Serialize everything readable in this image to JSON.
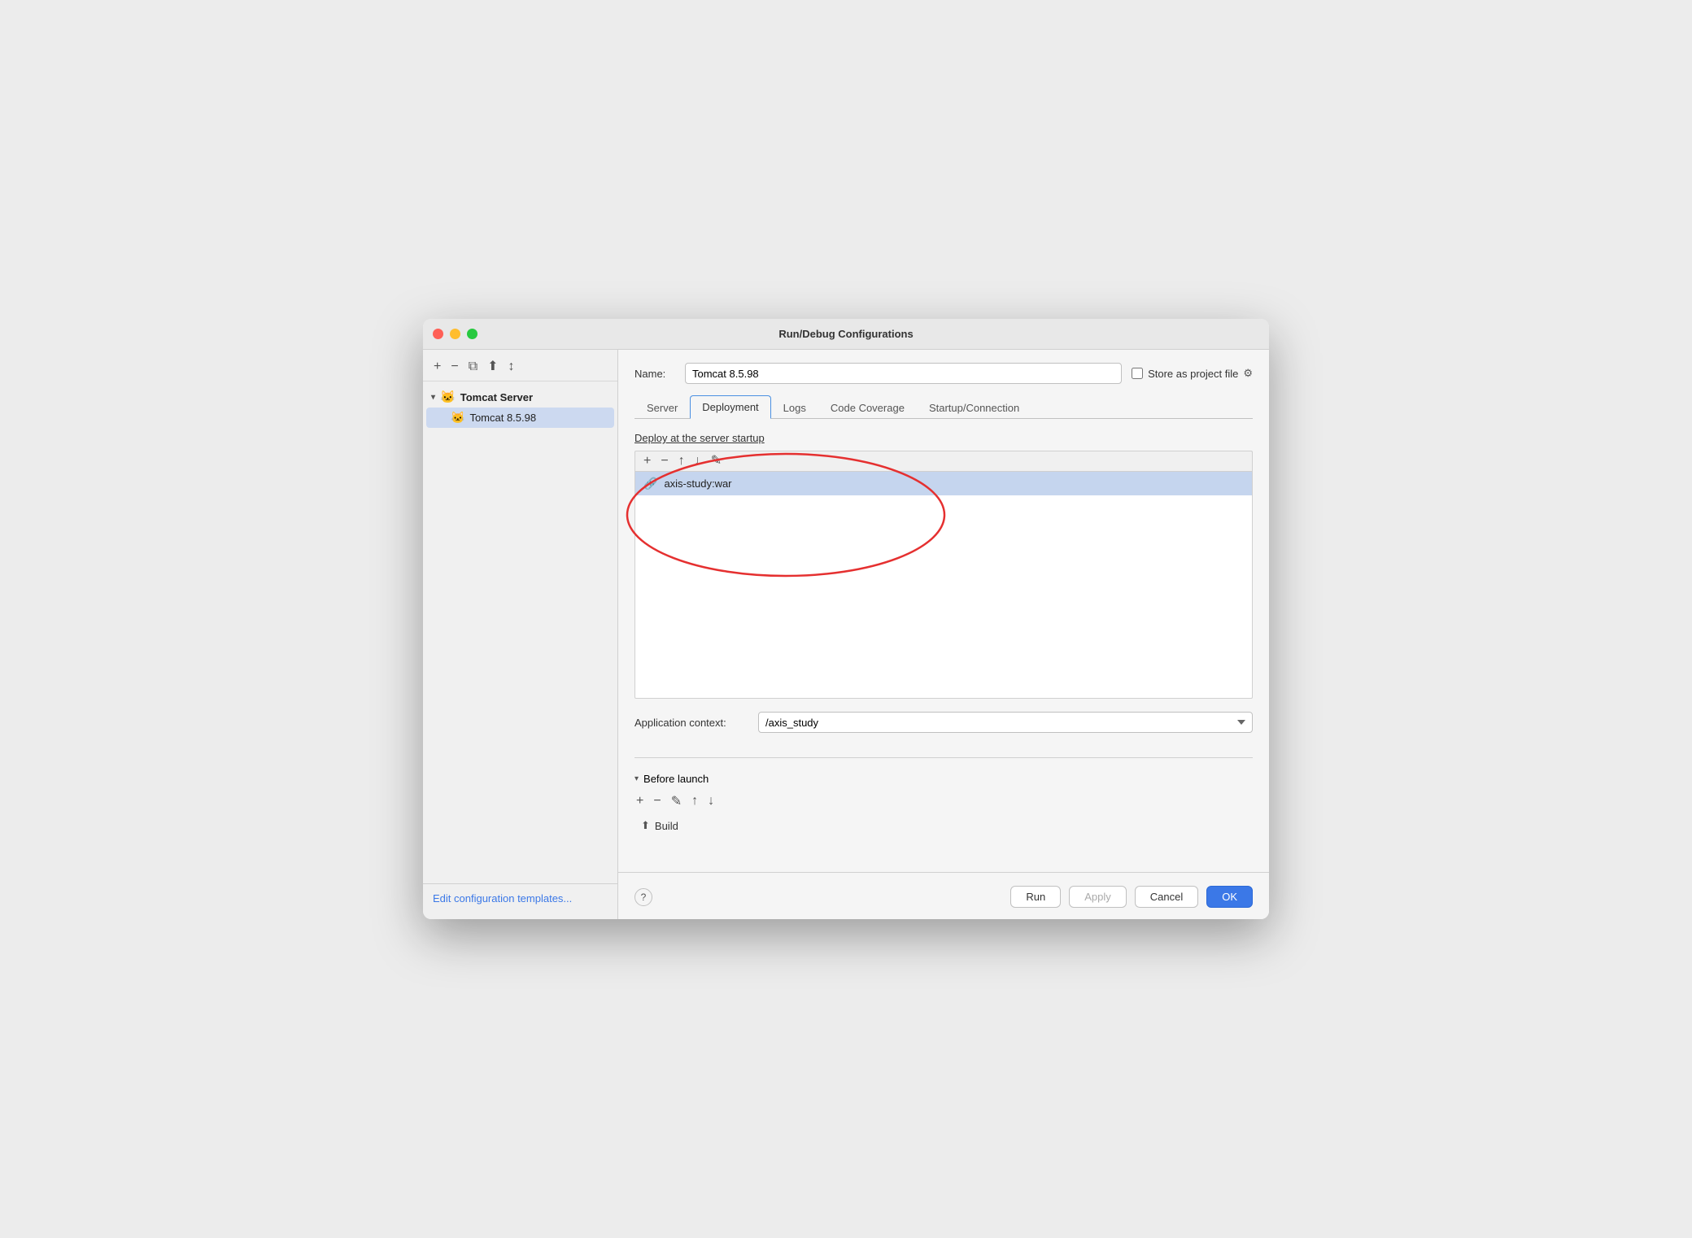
{
  "window": {
    "title": "Run/Debug Configurations"
  },
  "sidebar": {
    "tools": [
      "+",
      "−",
      "⧉",
      "⬆",
      "↕"
    ],
    "group": {
      "name": "Tomcat Server",
      "icon": "🐱",
      "items": [
        {
          "name": "Tomcat 8.5.98",
          "icon": "🐱",
          "selected": true
        }
      ]
    },
    "footer_link": "Edit configuration templates..."
  },
  "header": {
    "name_label": "Name:",
    "name_value": "Tomcat 8.5.98",
    "store_label": "Store as project file"
  },
  "tabs": [
    {
      "label": "Server",
      "active": false
    },
    {
      "label": "Deployment",
      "active": true
    },
    {
      "label": "Logs",
      "active": false
    },
    {
      "label": "Code Coverage",
      "active": false
    },
    {
      "label": "Startup/Connection",
      "active": false
    }
  ],
  "deployment": {
    "section_label": "Deploy at the server startup",
    "toolbar_buttons": [
      "+",
      "−",
      "↑",
      "↓",
      "✎"
    ],
    "items": [
      {
        "name": "axis-study:war",
        "icon": "🔗"
      }
    ],
    "context_label": "Application context:",
    "context_value": "/axis_study",
    "context_options": [
      "/axis_study"
    ]
  },
  "before_launch": {
    "label": "Before launch",
    "toolbar_buttons": [
      "+",
      "−",
      "✎",
      "↑",
      "↓"
    ],
    "items": [
      {
        "name": "Build",
        "icon": "⬆"
      }
    ]
  },
  "footer": {
    "help_label": "?",
    "run_label": "Run",
    "apply_label": "Apply",
    "cancel_label": "Cancel",
    "ok_label": "OK"
  }
}
